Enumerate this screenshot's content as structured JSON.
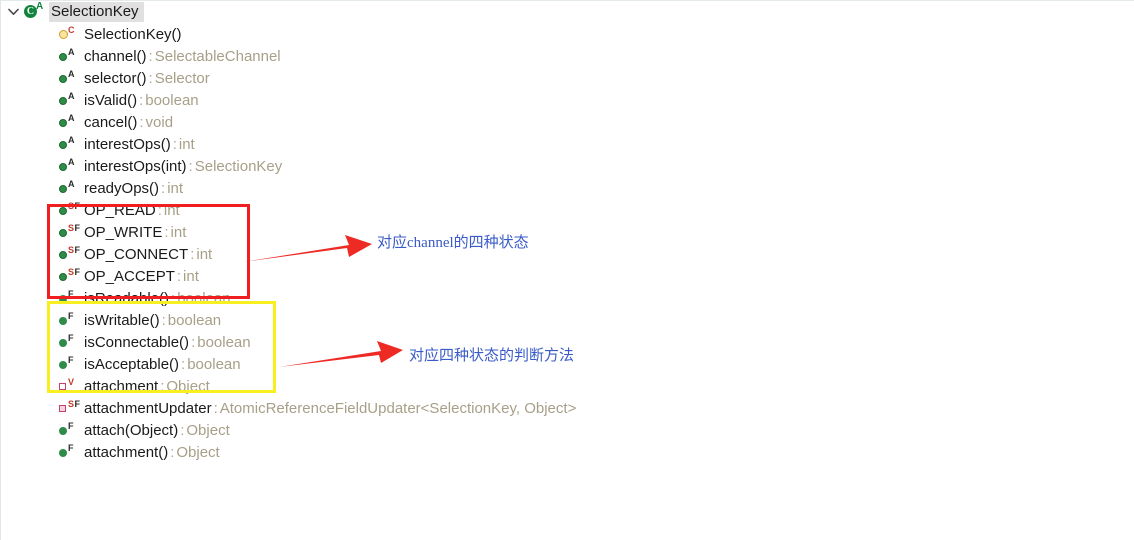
{
  "view": {
    "title": "SelectionKey",
    "root_icon": "class-icon",
    "root_icon_letter": "C",
    "root_modifier": "A",
    "expanded": true,
    "chevron_icon": "chevron-down-icon"
  },
  "members": [
    {
      "icon": "constructor-icon",
      "icon_kind": "orange-ring",
      "modifier": "C",
      "name": "SelectionKey()",
      "sep": "",
      "type": ""
    },
    {
      "icon": "method-icon",
      "icon_kind": "green-ring",
      "modifier": "A",
      "name": "channel()",
      "sep": ":",
      "type": "SelectableChannel"
    },
    {
      "icon": "method-icon",
      "icon_kind": "green-ring",
      "modifier": "A",
      "name": "selector()",
      "sep": ":",
      "type": "Selector"
    },
    {
      "icon": "method-icon",
      "icon_kind": "green-ring",
      "modifier": "A",
      "name": "isValid()",
      "sep": ":",
      "type": "boolean"
    },
    {
      "icon": "method-icon",
      "icon_kind": "green-ring",
      "modifier": "A",
      "name": "cancel()",
      "sep": ":",
      "type": "void"
    },
    {
      "icon": "method-icon",
      "icon_kind": "green-ring",
      "modifier": "A",
      "name": "interestOps()",
      "sep": ":",
      "type": "int"
    },
    {
      "icon": "method-icon",
      "icon_kind": "green-ring",
      "modifier": "A",
      "name": "interestOps(int)",
      "sep": ":",
      "type": "SelectionKey"
    },
    {
      "icon": "method-icon",
      "icon_kind": "green-ring",
      "modifier": "A",
      "name": "readyOps()",
      "sep": ":",
      "type": "int"
    },
    {
      "icon": "static-field-icon",
      "icon_kind": "green-ring",
      "modifier": "SF",
      "name": "OP_READ",
      "sep": ":",
      "type": "int"
    },
    {
      "icon": "static-field-icon",
      "icon_kind": "green-ring",
      "modifier": "SF",
      "name": "OP_WRITE",
      "sep": ":",
      "type": "int"
    },
    {
      "icon": "static-field-icon",
      "icon_kind": "green-ring",
      "modifier": "SF",
      "name": "OP_CONNECT",
      "sep": ":",
      "type": "int"
    },
    {
      "icon": "static-field-icon",
      "icon_kind": "green-ring",
      "modifier": "SF",
      "name": "OP_ACCEPT",
      "sep": ":",
      "type": "int"
    },
    {
      "icon": "method-icon",
      "icon_kind": "green-solid",
      "modifier": "F",
      "name": "isReadable()",
      "sep": ":",
      "type": "boolean"
    },
    {
      "icon": "method-icon",
      "icon_kind": "green-solid",
      "modifier": "F",
      "name": "isWritable()",
      "sep": ":",
      "type": "boolean"
    },
    {
      "icon": "method-icon",
      "icon_kind": "green-solid",
      "modifier": "F",
      "name": "isConnectable()",
      "sep": ":",
      "type": "boolean"
    },
    {
      "icon": "method-icon",
      "icon_kind": "green-solid",
      "modifier": "F",
      "name": "isAcceptable()",
      "sep": ":",
      "type": "boolean"
    },
    {
      "icon": "field-icon",
      "icon_kind": "pink-square",
      "modifier": "V",
      "name": "attachment",
      "sep": ":",
      "type": "Object"
    },
    {
      "icon": "static-field-icon",
      "icon_kind": "pink-square-filled",
      "modifier": "SF",
      "name": "attachmentUpdater",
      "sep": ":",
      "type": "AtomicReferenceFieldUpdater<SelectionKey, Object>"
    },
    {
      "icon": "method-icon",
      "icon_kind": "green-solid",
      "modifier": "F",
      "name": "attach(Object)",
      "sep": ":",
      "type": "Object"
    },
    {
      "icon": "method-icon",
      "icon_kind": "green-solid",
      "modifier": "F",
      "name": "attachment()",
      "sep": ":",
      "type": "Object"
    }
  ],
  "highlights": [
    {
      "id": "red-box",
      "color": "#f01e1e",
      "label": "op-constants-highlight"
    },
    {
      "id": "yellow-box",
      "color": "#f7ef1f",
      "label": "state-check-methods-highlight"
    }
  ],
  "annotations": [
    {
      "id": "annotation-1",
      "text": "对应channel的四种状态",
      "color": "#3a5bc7",
      "arrow_color": "#ee2a24"
    },
    {
      "id": "annotation-2",
      "text": "对应四种状态的判断方法",
      "color": "#3a5bc7",
      "arrow_color": "#ee2a24"
    }
  ],
  "colors": {
    "method_name": "#1a1a1a",
    "type_name": "#a79f88",
    "icon_green": "#2e8b48",
    "icon_orange": "#d19c2a",
    "icon_pink": "#c2436b",
    "selection_bg": "#e0e0e0"
  }
}
